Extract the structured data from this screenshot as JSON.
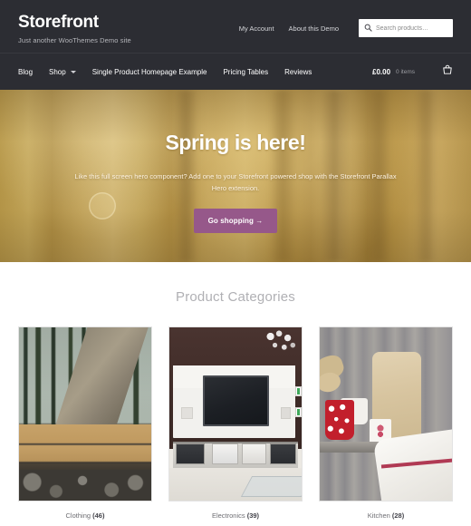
{
  "header": {
    "brand_title": "Storefront",
    "brand_tagline": "Just another WooThemes Demo site",
    "secondary_nav": [
      {
        "label": "My Account"
      },
      {
        "label": "About this Demo"
      }
    ],
    "search": {
      "placeholder": "Search products…",
      "value": "",
      "icon": "search-icon"
    },
    "primary_nav": [
      {
        "label": "Blog",
        "has_dropdown": false
      },
      {
        "label": "Shop",
        "has_dropdown": true
      },
      {
        "label": "Single Product Homepage Example",
        "has_dropdown": false
      },
      {
        "label": "Pricing Tables",
        "has_dropdown": false
      },
      {
        "label": "Reviews",
        "has_dropdown": false
      }
    ],
    "cart": {
      "amount": "£0.00",
      "count": "0 items",
      "icon": "shopping-cart-icon"
    }
  },
  "hero": {
    "title": "Spring is here!",
    "description": "Like this full screen hero component? Add one to your Storefront powered shop with the Storefront Parallax Hero extension.",
    "button_label": "Go shopping →"
  },
  "categories_section": {
    "title": "Product Categories",
    "items": [
      {
        "name": "Clothing",
        "count": "(46)",
        "image": "forest-boots-on-deck"
      },
      {
        "name": "Electronics",
        "count": "(39)",
        "image": "flatscreen-tv-media-wall"
      },
      {
        "name": "Kitchen",
        "count": "(28)",
        "image": "red-polkadot-mugs-cutting-board"
      }
    ]
  },
  "colors": {
    "header_bg": "#2c2d33",
    "accent_purple": "#96588a",
    "hero_gold": "#c2a25a",
    "page_bg": "#ffffff",
    "muted_text": "#b0b0b4"
  }
}
